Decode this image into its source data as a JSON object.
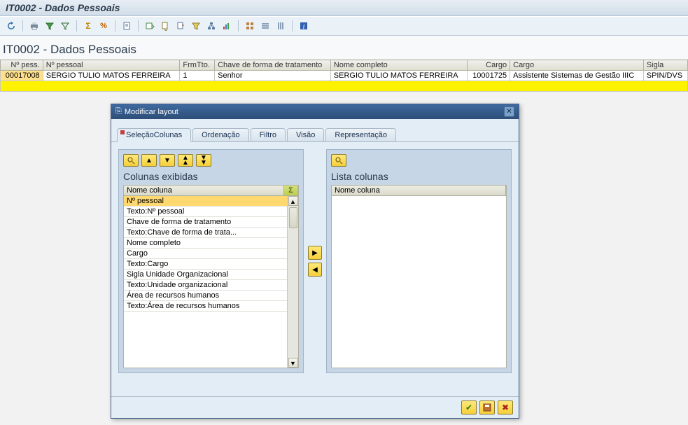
{
  "title_bar": "IT0002 - Dados Pessoais",
  "page_heading": "IT0002 - Dados Pessoais",
  "table": {
    "columns": [
      "Nº pess.",
      "Nº pessoal",
      "FrmTto.",
      "Chave de forma de tratamento",
      "Nome completo",
      "Cargo",
      "Cargo",
      "Sigla"
    ],
    "row": {
      "pess_no": "00017008",
      "np_pessoal": "SERGIO TULIO MATOS FERREIRA",
      "frmtto": "1",
      "chave": "Senhor",
      "nome_completo": "SERGIO TULIO MATOS FERREIRA",
      "cargo_code": "10001725",
      "cargo_desc": "Assistente Sistemas de Gestão IIIC",
      "sigla": "SPIN/DVS"
    }
  },
  "dialog": {
    "title": "Modificar layout",
    "tabs": [
      "SeleçãoColunas",
      "Ordenação",
      "Filtro",
      "Visão",
      "Representação"
    ],
    "left_panel": {
      "title": "Colunas exibidas",
      "col_header": "Nome coluna",
      "sum_header": "Σ",
      "items": [
        "Nº pessoal",
        "Texto:Nº pessoal",
        "Chave de forma de tratamento",
        "Texto:Chave de forma de trata...",
        "Nome completo",
        "Cargo",
        "Texto:Cargo",
        "Sigla Unidade Organizacional",
        "Texto:Unidade organizacional",
        "Área de recursos humanos",
        "Texto:Área de recursos humanos"
      ]
    },
    "right_panel": {
      "title": "Lista colunas",
      "col_header": "Nome coluna"
    }
  }
}
